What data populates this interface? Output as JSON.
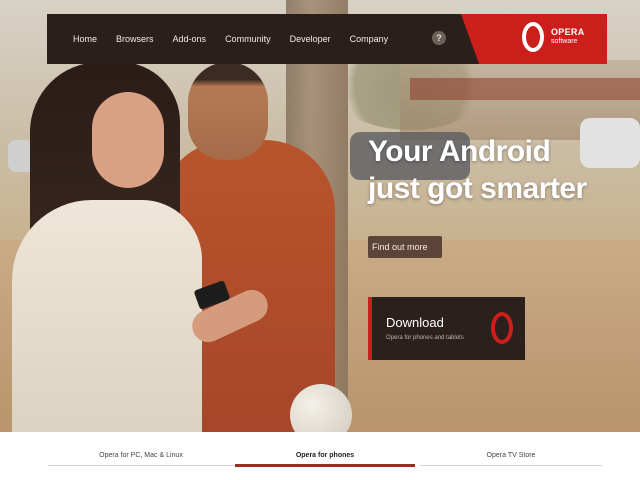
{
  "nav": {
    "items": [
      "Home",
      "Browsers",
      "Add-ons",
      "Community",
      "Developer",
      "Company"
    ],
    "help_label": "?",
    "brand": {
      "name": "OPERA",
      "subtitle": "software"
    }
  },
  "hero": {
    "headline_line1": "Your Android",
    "headline_line2": "just got smarter",
    "find_out_more": "Find out more",
    "download_title": "Download",
    "download_subtitle": "Opera for phones and tablets"
  },
  "tabs": [
    {
      "label": "Opera for PC, Mac & Linux",
      "active": false
    },
    {
      "label": "Opera for phones",
      "active": true
    },
    {
      "label": "Opera TV Store",
      "active": false
    }
  ],
  "colors": {
    "accent": "#cc1f1c",
    "nav_bg": "#2a1f1b",
    "active_tab": "#9b2c1f"
  }
}
